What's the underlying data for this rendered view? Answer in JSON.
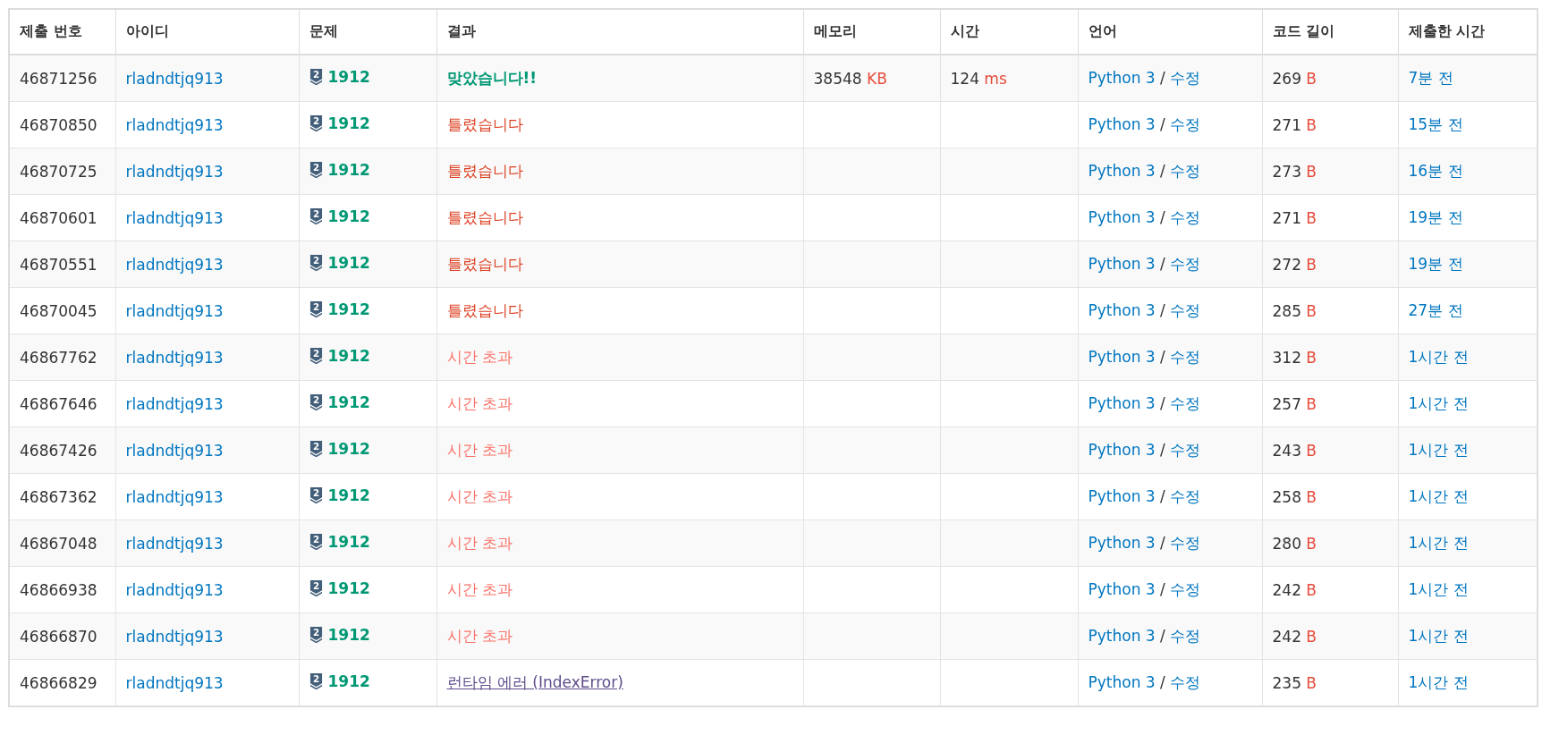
{
  "table": {
    "columns": [
      "제출 번호",
      "아이디",
      "문제",
      "결과",
      "메모리",
      "시간",
      "언어",
      "코드 길이",
      "제출한 시간"
    ],
    "rows": [
      {
        "id": "46871256",
        "user": "rladndtjq913",
        "tier": "2",
        "problem": "1912",
        "result": {
          "kind": "accepted",
          "text": "맞았습니다!!"
        },
        "memory": "38548",
        "memory_unit": "KB",
        "time": "124",
        "time_unit": "ms",
        "language": "Python 3",
        "separator": "/",
        "edit": "수정",
        "length": "269",
        "length_unit": "B",
        "submitted": "7분 전"
      },
      {
        "id": "46870850",
        "user": "rladndtjq913",
        "tier": "2",
        "problem": "1912",
        "result": {
          "kind": "wrong",
          "text": "틀렸습니다"
        },
        "language": "Python 3",
        "separator": "/",
        "edit": "수정",
        "length": "271",
        "length_unit": "B",
        "submitted": "15분 전"
      },
      {
        "id": "46870725",
        "user": "rladndtjq913",
        "tier": "2",
        "problem": "1912",
        "result": {
          "kind": "wrong",
          "text": "틀렸습니다"
        },
        "language": "Python 3",
        "separator": "/",
        "edit": "수정",
        "length": "273",
        "length_unit": "B",
        "submitted": "16분 전"
      },
      {
        "id": "46870601",
        "user": "rladndtjq913",
        "tier": "2",
        "problem": "1912",
        "result": {
          "kind": "wrong",
          "text": "틀렸습니다"
        },
        "language": "Python 3",
        "separator": "/",
        "edit": "수정",
        "length": "271",
        "length_unit": "B",
        "submitted": "19분 전"
      },
      {
        "id": "46870551",
        "user": "rladndtjq913",
        "tier": "2",
        "problem": "1912",
        "result": {
          "kind": "wrong",
          "text": "틀렸습니다"
        },
        "language": "Python 3",
        "separator": "/",
        "edit": "수정",
        "length": "272",
        "length_unit": "B",
        "submitted": "19분 전"
      },
      {
        "id": "46870045",
        "user": "rladndtjq913",
        "tier": "2",
        "problem": "1912",
        "result": {
          "kind": "wrong",
          "text": "틀렸습니다"
        },
        "language": "Python 3",
        "separator": "/",
        "edit": "수정",
        "length": "285",
        "length_unit": "B",
        "submitted": "27분 전"
      },
      {
        "id": "46867762",
        "user": "rladndtjq913",
        "tier": "2",
        "problem": "1912",
        "result": {
          "kind": "timeout",
          "text": "시간 초과"
        },
        "language": "Python 3",
        "separator": "/",
        "edit": "수정",
        "length": "312",
        "length_unit": "B",
        "submitted": "1시간 전"
      },
      {
        "id": "46867646",
        "user": "rladndtjq913",
        "tier": "2",
        "problem": "1912",
        "result": {
          "kind": "timeout",
          "text": "시간 초과"
        },
        "language": "Python 3",
        "separator": "/",
        "edit": "수정",
        "length": "257",
        "length_unit": "B",
        "submitted": "1시간 전"
      },
      {
        "id": "46867426",
        "user": "rladndtjq913",
        "tier": "2",
        "problem": "1912",
        "result": {
          "kind": "timeout",
          "text": "시간 초과"
        },
        "language": "Python 3",
        "separator": "/",
        "edit": "수정",
        "length": "243",
        "length_unit": "B",
        "submitted": "1시간 전"
      },
      {
        "id": "46867362",
        "user": "rladndtjq913",
        "tier": "2",
        "problem": "1912",
        "result": {
          "kind": "timeout",
          "text": "시간 초과"
        },
        "language": "Python 3",
        "separator": "/",
        "edit": "수정",
        "length": "258",
        "length_unit": "B",
        "submitted": "1시간 전"
      },
      {
        "id": "46867048",
        "user": "rladndtjq913",
        "tier": "2",
        "problem": "1912",
        "result": {
          "kind": "timeout",
          "text": "시간 초과"
        },
        "language": "Python 3",
        "separator": "/",
        "edit": "수정",
        "length": "280",
        "length_unit": "B",
        "submitted": "1시간 전"
      },
      {
        "id": "46866938",
        "user": "rladndtjq913",
        "tier": "2",
        "problem": "1912",
        "result": {
          "kind": "timeout",
          "text": "시간 초과"
        },
        "language": "Python 3",
        "separator": "/",
        "edit": "수정",
        "length": "242",
        "length_unit": "B",
        "submitted": "1시간 전"
      },
      {
        "id": "46866870",
        "user": "rladndtjq913",
        "tier": "2",
        "problem": "1912",
        "result": {
          "kind": "timeout",
          "text": "시간 초과"
        },
        "language": "Python 3",
        "separator": "/",
        "edit": "수정",
        "length": "242",
        "length_unit": "B",
        "submitted": "1시간 전"
      },
      {
        "id": "46866829",
        "user": "rladndtjq913",
        "tier": "2",
        "problem": "1912",
        "result": {
          "kind": "runtime_error",
          "text": "런타임 에러 (IndexError)"
        },
        "language": "Python 3",
        "separator": "/",
        "edit": "수정",
        "length": "235",
        "length_unit": "B",
        "submitted": "1시간 전"
      }
    ]
  }
}
